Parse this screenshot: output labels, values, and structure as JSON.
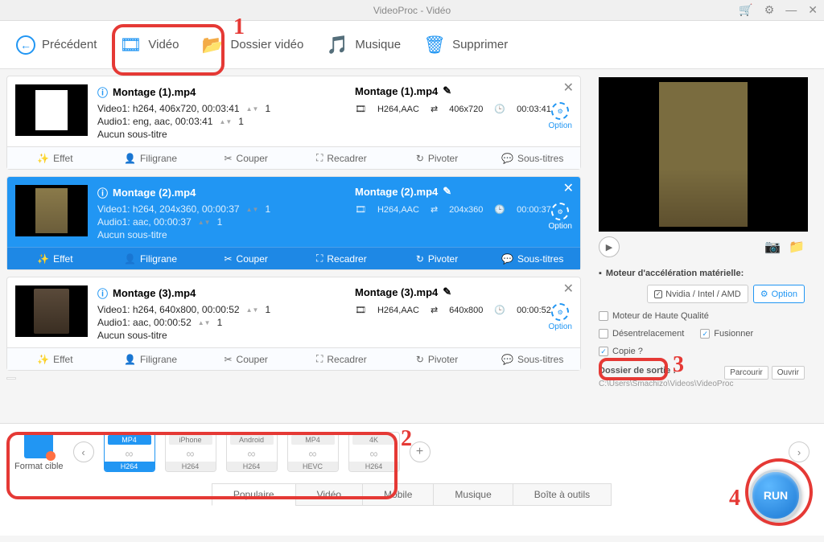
{
  "window": {
    "title": "VideoProc - Vidéo"
  },
  "titlebar_icons": [
    "🛒",
    "⚙",
    "—",
    "✕"
  ],
  "toolbar": {
    "back": "Précédent",
    "video": "Vidéo",
    "folder": "Dossier vidéo",
    "music": "Musique",
    "delete": "Supprimer"
  },
  "tools": {
    "effect": "Effet",
    "watermark": "Filigrane",
    "cut": "Couper",
    "crop": "Recadrer",
    "rotate": "Pivoter",
    "subs": "Sous-titres"
  },
  "option_label": "Option",
  "items": [
    {
      "title_left": "Montage          (1).mp4",
      "video": "Video1: h264, 406x720, 00:03:41",
      "audio": "Audio1: eng, aac, 00:03:41",
      "sub": "Aucun sous-titre",
      "title_right": "Montage          (1).mp4",
      "codec": "H264,AAC",
      "res": "406x720",
      "dur": "00:03:41",
      "track_v": "1",
      "track_a": "1"
    },
    {
      "title_left": "Montage          (2).mp4",
      "video": "Video1: h264, 204x360, 00:00:37",
      "audio": "Audio1: aac, 00:00:37",
      "sub": "Aucun sous-titre",
      "title_right": "Montage          (2).mp4",
      "codec": "H264,AAC",
      "res": "204x360",
      "dur": "00:00:37",
      "track_v": "1",
      "track_a": "1"
    },
    {
      "title_left": "Montage          (3).mp4",
      "video": "Video1: h264, 640x800, 00:00:52",
      "audio": "Audio1: aac, 00:00:52",
      "sub": "Aucun sous-titre",
      "title_right": "Montage          (3).mp4",
      "codec": "H264,AAC",
      "res": "640x800",
      "dur": "00:00:52",
      "track_v": "1",
      "track_a": "1"
    }
  ],
  "side": {
    "hwaccel_label": "Moteur d'accélération matérielle:",
    "gpu": "Nvidia / Intel / AMD",
    "option_btn": "Option",
    "hq": "Moteur de Haute Qualité",
    "deint": "Désentrelacement",
    "merge": "Fusionner",
    "copy": "Copie ?",
    "out_label": "Dossier de sortie :",
    "out_path": "C:\\Users\\Smachizo\\Videos\\VideoProc",
    "browse": "Parcourir",
    "open": "Ouvrir"
  },
  "formats": {
    "label": "Format cible",
    "items": [
      {
        "top": "MP4",
        "bot": "H264",
        "sel": true
      },
      {
        "top": "iPhone",
        "bot": "H264"
      },
      {
        "top": "Android",
        "bot": "H264"
      },
      {
        "top": "MP4",
        "bot": "HEVC"
      },
      {
        "top": "4K",
        "bot": "H264"
      }
    ]
  },
  "tabs": [
    "Populaire",
    "Vidéo",
    "Mobile",
    "Musique",
    "Boîte à outils"
  ],
  "run": "RUN",
  "anno": {
    "n1": "1",
    "n2": "2",
    "n3": "3",
    "n4": "4"
  }
}
